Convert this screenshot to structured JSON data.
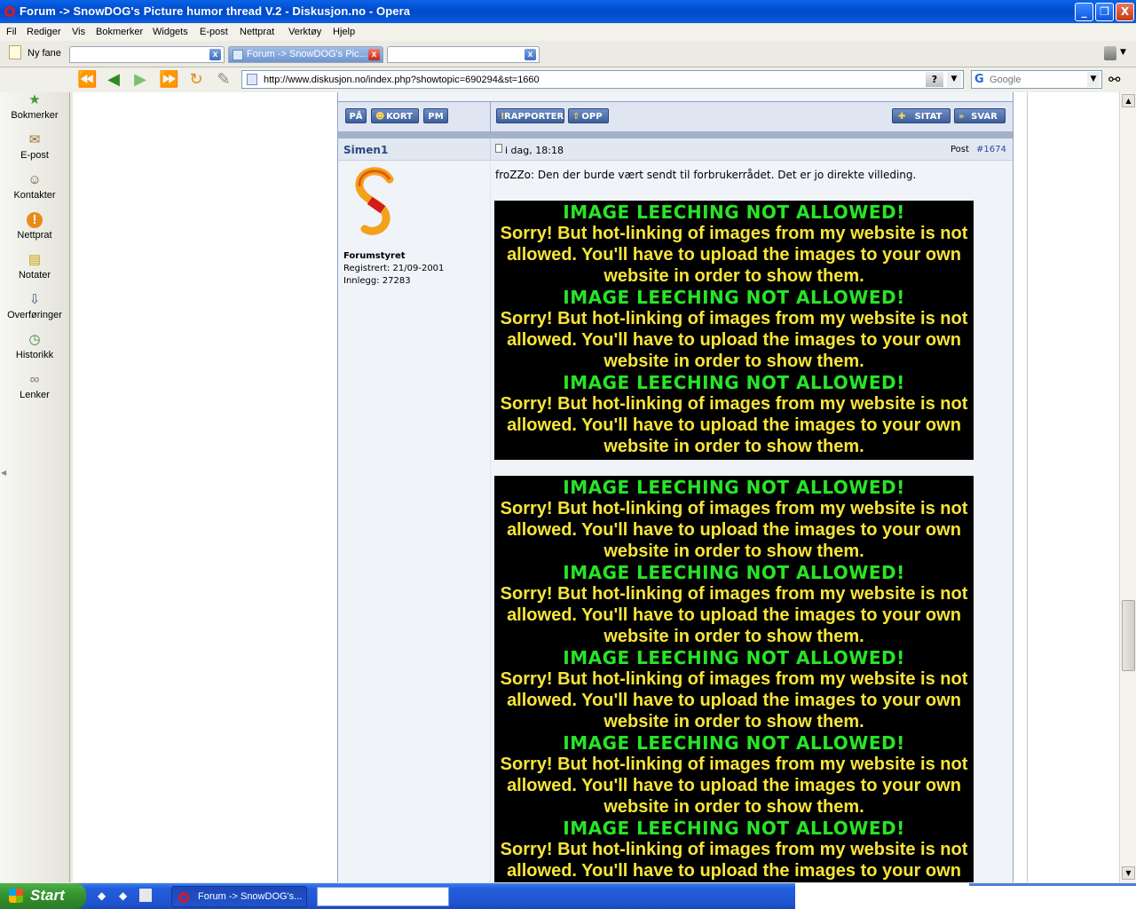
{
  "window": {
    "title": "Forum -> SnowDOG's Picture humor thread V.2 - Diskusjon.no - Opera",
    "minimize": "_",
    "maximize": "❐",
    "close": "X"
  },
  "menu": [
    "Fil",
    "Rediger",
    "Vis",
    "Bokmerker",
    "Widgets",
    "E-post",
    "Nettprat",
    "Verktøy",
    "Hjelp"
  ],
  "tabs": {
    "new_tab_label": "Ny fane",
    "items": [
      {
        "label": "",
        "active": false
      },
      {
        "label": "Forum -> SnowDOG's Pic...",
        "active": true
      },
      {
        "label": "",
        "active": false
      }
    ],
    "close_glyph": "x"
  },
  "nav": {
    "url": "http://www.diskusjon.no/index.php?showtopic=690294&st=1660",
    "help_glyph": "?",
    "dropdown_glyph": "▼",
    "search_placeholder": "Google",
    "search_engine_glyph": "G"
  },
  "panel": [
    {
      "label": "Bokmerker",
      "icon": "bookmarks-icon",
      "glyph": "★"
    },
    {
      "label": "E-post",
      "icon": "mail-icon",
      "glyph": "✉"
    },
    {
      "label": "Kontakter",
      "icon": "contacts-icon",
      "glyph": "☺"
    },
    {
      "label": "Nettprat",
      "icon": "chat-icon",
      "glyph": "!"
    },
    {
      "label": "Notater",
      "icon": "notes-icon",
      "glyph": "▤"
    },
    {
      "label": "Overføringer",
      "icon": "transfers-icon",
      "glyph": "⇩"
    },
    {
      "label": "Historikk",
      "icon": "history-icon",
      "glyph": "◷"
    },
    {
      "label": "Lenker",
      "icon": "links-icon",
      "glyph": "∞"
    }
  ],
  "post_toolbar": {
    "left_buttons": [
      "PÅ",
      "KORT",
      "PM"
    ],
    "report": "RAPPORTER",
    "up": "OPP",
    "quote": "SITAT",
    "reply": "SVAR"
  },
  "post": {
    "author": "Simen1",
    "date": "i dag, 18:18",
    "post_label": "Post",
    "post_number": "#1674",
    "group": "Forumstyret",
    "registered": "Registrert: 21/09-2001",
    "posts": "Innlegg: 27283",
    "text": "froZZo: Den der burde vært sendt til forbrukerrådet. Det er jo direkte villeding."
  },
  "leech": {
    "headline": "IMAGE LEECHING NOT ALLOWED!",
    "body": "Sorry! But hot-linking of images from my website is not allowed. You'll have to upload the images to your own website in order to show them."
  },
  "taskbar": {
    "start": "Start",
    "task_label": "Forum -> SnowDOG's..."
  }
}
